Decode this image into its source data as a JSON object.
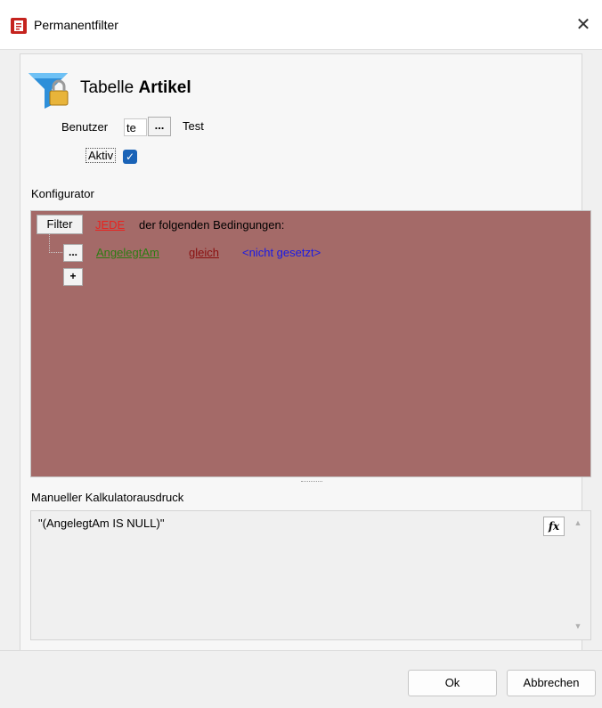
{
  "window": {
    "title": "Permanentfilter",
    "close_glyph": "✕"
  },
  "header": {
    "prefix": "Tabelle",
    "table": "Artikel"
  },
  "user": {
    "label": "Benutzer",
    "value": "te",
    "browse_label": "...",
    "name": "Test"
  },
  "active": {
    "label": "Aktiv",
    "checked": true
  },
  "configurator": {
    "label": "Konfigurator",
    "filter_button": "Filter",
    "quantifier": "JEDE",
    "quantifier_suffix": "der folgenden Bedingungen:",
    "condition": {
      "menu": "...",
      "field": "AngelegtAm",
      "operator": "gleich",
      "value": "<nicht gesetzt>"
    },
    "add_button": "+",
    "background": "#a46a68"
  },
  "expression": {
    "label": "Manueller Kalkulatorausdruck",
    "text": "\"(AngelegtAm IS NULL)\"",
    "fx_label": "fx"
  },
  "buttons": {
    "ok": "Ok",
    "cancel": "Abbrechen"
  },
  "colors": {
    "link_red": "#e8231f",
    "link_green": "#2b7c12",
    "link_darkred": "#8a0f0f",
    "link_blue": "#1a1ae6"
  }
}
